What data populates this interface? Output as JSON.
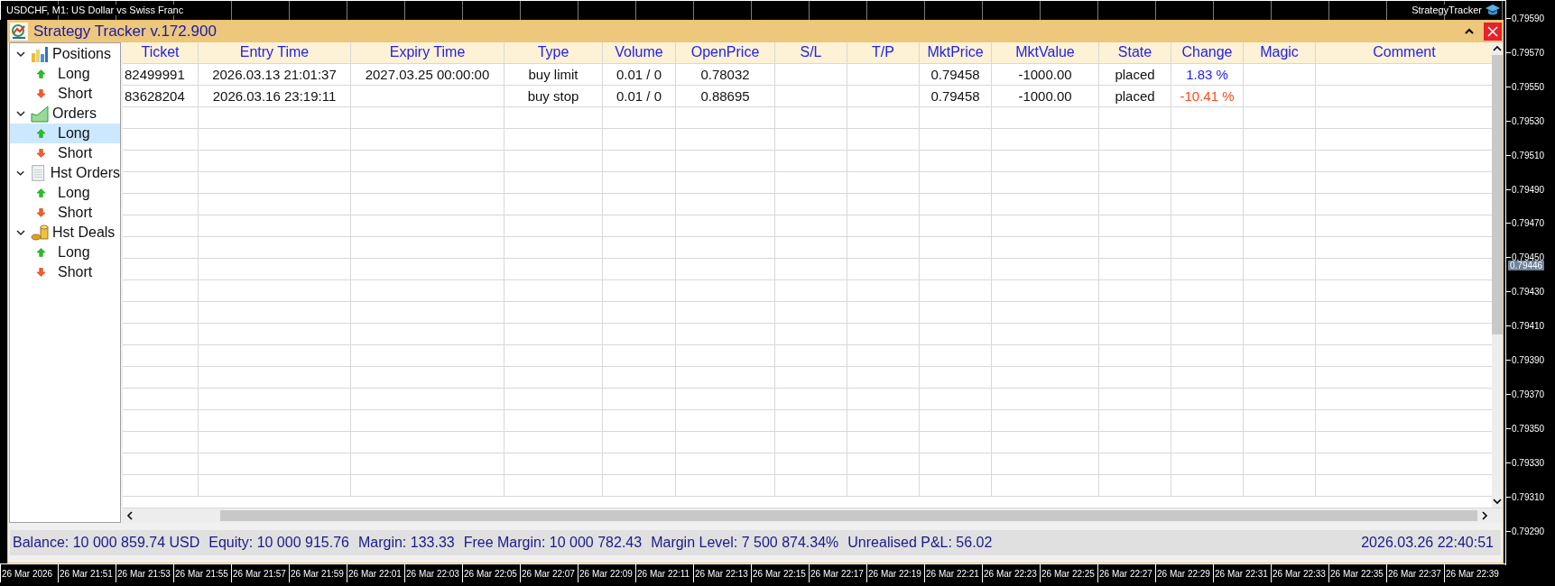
{
  "chart": {
    "symbol_title": "USDCHF, M1:  US Dollar vs Swiss Franc",
    "indicator_label": "StrategyTracker",
    "price_labels": [
      "0.79590",
      "0.79570",
      "0.79550",
      "0.79530",
      "0.79510",
      "0.79490",
      "0.79470",
      "0.79450",
      "0.79430",
      "0.79410",
      "0.79390",
      "0.79370",
      "0.79350",
      "0.79330",
      "0.79310",
      "0.79290"
    ],
    "current_price": "0.79446",
    "time_labels": [
      "26 Mar 2026",
      "26 Mar 21:51",
      "26 Mar 21:53",
      "26 Mar 21:55",
      "26 Mar 21:57",
      "26 Mar 21:59",
      "26 Mar 22:01",
      "26 Mar 22:03",
      "26 Mar 22:05",
      "26 Mar 22:07",
      "26 Mar 22:09",
      "26 Mar 22:11",
      "26 Mar 22:13",
      "26 Mar 22:15",
      "26 Mar 22:17",
      "26 Mar 22:19",
      "26 Mar 22:21",
      "26 Mar 22:23",
      "26 Mar 22:25",
      "26 Mar 22:27",
      "26 Mar 22:29",
      "26 Mar 22:31",
      "26 Mar 22:33",
      "26 Mar 22:35",
      "26 Mar 22:37",
      "26 Mar 22:39"
    ]
  },
  "window": {
    "title": "Strategy Tracker v.172.900"
  },
  "sidebar": {
    "items": [
      {
        "label": "Positions",
        "expanded": true,
        "children": [
          {
            "label": "Long",
            "kind": "long",
            "selected": false
          },
          {
            "label": "Short",
            "kind": "short",
            "selected": false
          }
        ]
      },
      {
        "label": "Orders",
        "expanded": true,
        "children": [
          {
            "label": "Long",
            "kind": "long",
            "selected": true
          },
          {
            "label": "Short",
            "kind": "short",
            "selected": false
          }
        ]
      },
      {
        "label": "Hst Orders",
        "expanded": true,
        "children": [
          {
            "label": "Long",
            "kind": "long",
            "selected": false
          },
          {
            "label": "Short",
            "kind": "short",
            "selected": false
          }
        ]
      },
      {
        "label": "Hst Deals",
        "expanded": true,
        "children": [
          {
            "label": "Long",
            "kind": "long",
            "selected": false
          },
          {
            "label": "Short",
            "kind": "short",
            "selected": false
          }
        ]
      }
    ]
  },
  "table": {
    "columns": [
      "Ticket",
      "Entry Time",
      "Expiry Time",
      "Type",
      "Volume",
      "OpenPrice",
      "S/L",
      "T/P",
      "MktPrice",
      "MktValue",
      "State",
      "Change",
      "Magic",
      "Comment"
    ],
    "rows": [
      {
        "ticket": "82499991",
        "entry_time": "2026.03.13 21:01:37",
        "expiry_time": "2027.03.25 00:00:00",
        "type": "buy limit",
        "volume": "0.01 / 0",
        "open_price": "0.78032",
        "market_price": "0.79458",
        "market_value": "-1000.00",
        "state": "placed",
        "change": {
          "text": "1.83 %",
          "color": "#1f1ff0"
        }
      },
      {
        "ticket": "83628204",
        "entry_time": "2026.03.16 23:19:11",
        "type": "buy stop",
        "volume": "0.01 / 0",
        "open_price": "0.88695",
        "market_price": "0.79458",
        "market_value": "-1000.00",
        "state": "placed",
        "change": {
          "text": "-10.41 %",
          "color": "#ff4a1a"
        }
      }
    ]
  },
  "status_bar": {
    "items": [
      "Balance: 10 000 859.74 USD",
      "Equity: 10 000 915.76",
      "Margin: 133.33",
      "Free Margin: 10 000 782.43",
      "Margin Level: 7 500 874.34%",
      "Unrealised P&L: 56.02"
    ],
    "time": "2026.03.26 22:40:51"
  }
}
